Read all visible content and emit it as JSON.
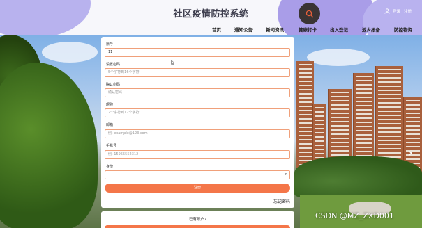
{
  "header": {
    "site_title": "社区疫情防控系统",
    "user_links": {
      "login": "登录",
      "register": "注册"
    },
    "nav": [
      "首页",
      "通知公告",
      "新闻资讯",
      "健康打卡",
      "出入登记",
      "返乡报备",
      "防控物资"
    ]
  },
  "form": {
    "fields": [
      {
        "label": "账号",
        "value": "11",
        "placeholder": ""
      },
      {
        "label": "设置密码",
        "value": "",
        "placeholder": "5个字符到16个字符"
      },
      {
        "label": "确认密码",
        "value": "",
        "placeholder": "确认密码"
      },
      {
        "label": "昵称",
        "value": "",
        "placeholder": "2个字符到12个字符"
      },
      {
        "label": "邮箱",
        "value": "",
        "placeholder": "例: example@123.com"
      },
      {
        "label": "手机号",
        "value": "",
        "placeholder": "例: 15955552312"
      }
    ],
    "identity_label": "身份",
    "identity_value": "",
    "register_button": "注册",
    "forgot_password": "忘记密码"
  },
  "bottom": {
    "has_account": "已有账户?"
  },
  "carousel": {
    "next_arrow": "›"
  },
  "watermark": "CSDN @MZ_ZXD001",
  "colors": {
    "accent": "#f47649",
    "input_border": "#f0a07a",
    "header_bg": "#f7f7fb",
    "blob": "#a99de8"
  },
  "icons": [
    "search-icon",
    "user-icon",
    "chevron-right-icon",
    "cursor-icon"
  ]
}
